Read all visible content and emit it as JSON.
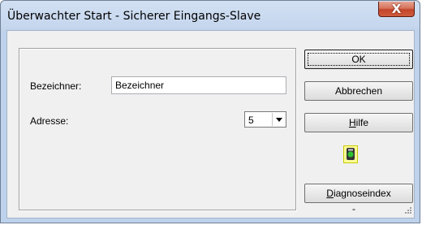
{
  "window": {
    "title": "Überwachter Start - Sicherer Eingangs-Slave",
    "close_glyph": "X"
  },
  "form": {
    "name_label": "Bezeichner:",
    "name_value": "Bezeichner",
    "address_label": "Adresse:",
    "address_value": "5"
  },
  "buttons": {
    "ok": "OK",
    "cancel": "Abbrechen",
    "help_mnemonic": "H",
    "help_rest": "ilfe",
    "diag_mnemonic": "D",
    "diag_rest": "iagnoseindex"
  },
  "status": {
    "icon": "status-light-icon",
    "led_color": "#2fbf2f",
    "diagnose_value": "-"
  }
}
